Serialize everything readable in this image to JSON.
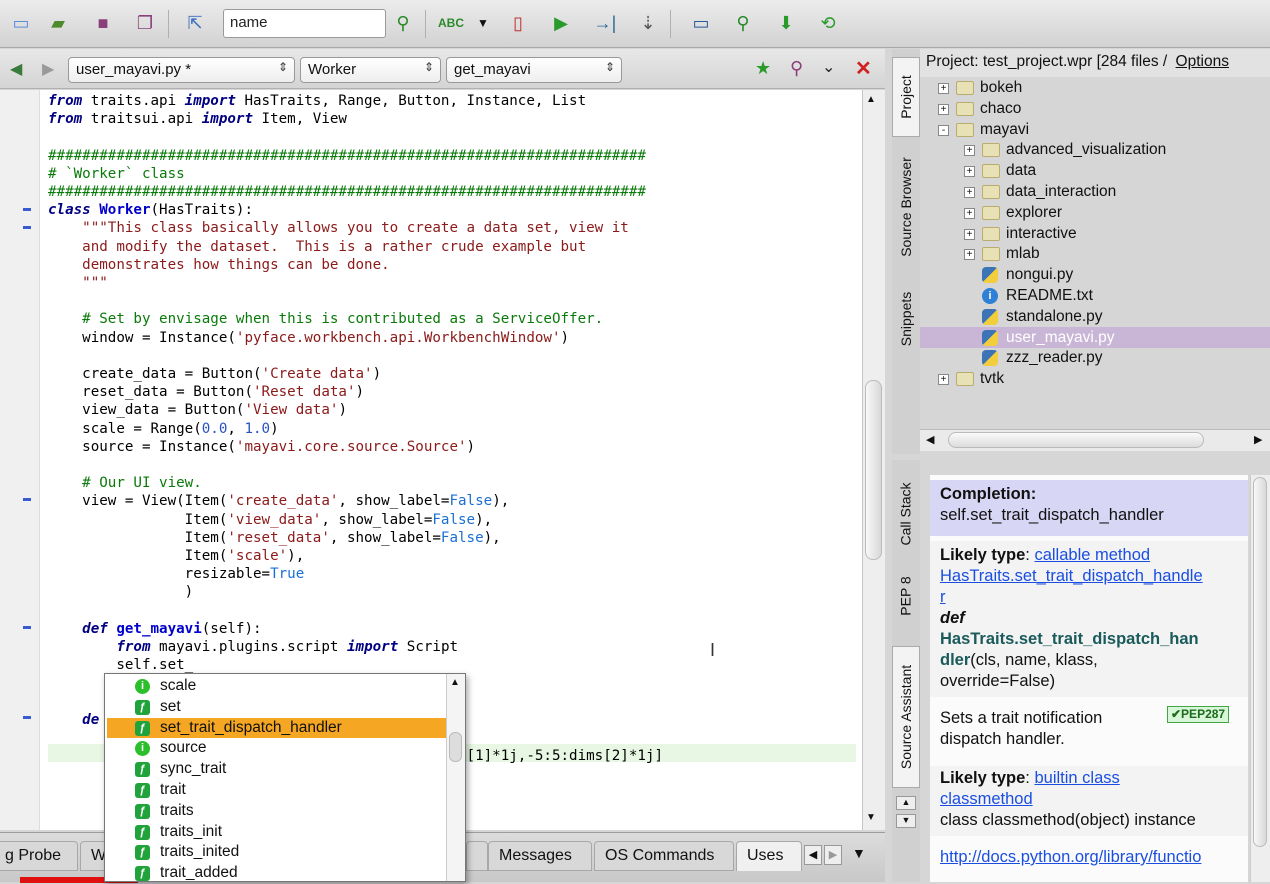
{
  "toolbar": {
    "search_value": "name"
  },
  "editor_nav": {
    "file": "user_mayavi.py *",
    "scope": "Worker",
    "method": "get_mayavi"
  },
  "completion": {
    "items": [
      {
        "label": "scale",
        "kind": "attribute"
      },
      {
        "label": "set",
        "kind": "method"
      },
      {
        "label": "set_trait_dispatch_handler",
        "kind": "method",
        "selected": true
      },
      {
        "label": "source",
        "kind": "attribute"
      },
      {
        "label": "sync_trait",
        "kind": "method"
      },
      {
        "label": "trait",
        "kind": "method"
      },
      {
        "label": "traits",
        "kind": "method"
      },
      {
        "label": "traits_init",
        "kind": "method"
      },
      {
        "label": "traits_inited",
        "kind": "method"
      },
      {
        "label": "trait_added",
        "kind": "method"
      }
    ]
  },
  "bottom_tabs": [
    "g Probe",
    "W",
    "Messages",
    "OS Commands",
    "Uses"
  ],
  "project": {
    "title": "Project: test_project.wpr [284 files /",
    "options": "Options"
  },
  "tree": [
    {
      "label": "bokeh",
      "level": 0,
      "type": "folder",
      "expand": "+"
    },
    {
      "label": "chaco",
      "level": 0,
      "type": "folder",
      "expand": "+"
    },
    {
      "label": "mayavi",
      "level": 0,
      "type": "folder",
      "expand": "-"
    },
    {
      "label": "advanced_visualization",
      "level": 1,
      "type": "folder",
      "expand": "+"
    },
    {
      "label": "data",
      "level": 1,
      "type": "folder",
      "expand": "+"
    },
    {
      "label": "data_interaction",
      "level": 1,
      "type": "folder",
      "expand": "+"
    },
    {
      "label": "explorer",
      "level": 1,
      "type": "folder",
      "expand": "+"
    },
    {
      "label": "interactive",
      "level": 1,
      "type": "folder",
      "expand": "+"
    },
    {
      "label": "mlab",
      "level": 1,
      "type": "folder",
      "expand": "+"
    },
    {
      "label": "nongui.py",
      "level": 1,
      "type": "py"
    },
    {
      "label": "README.txt",
      "level": 1,
      "type": "info"
    },
    {
      "label": "standalone.py",
      "level": 1,
      "type": "py"
    },
    {
      "label": "user_mayavi.py",
      "level": 1,
      "type": "py",
      "selected": true
    },
    {
      "label": "zzz_reader.py",
      "level": 1,
      "type": "py"
    },
    {
      "label": "tvtk",
      "level": 0,
      "type": "folder",
      "expand": "+"
    }
  ],
  "right_tabs_top": [
    "Project",
    "Source Browser",
    "Snippets"
  ],
  "right_tabs_bottom": [
    "Call Stack",
    "PEP 8",
    "Source Assistant"
  ],
  "assistant": {
    "completion_label": "Completion:",
    "completion_value": "self.set_trait_dispatch_handler",
    "likely_type_label": "Likely type",
    "likely_type_1": "callable method",
    "link_1": "HasTraits.set_trait_dispatch_handle",
    "link_1b": "r",
    "def_kw": "def",
    "sig_1": "HasTraits.set_trait_dispatch_han",
    "sig_2": "dler",
    "sig_3": "(cls, name, klass,",
    "sig_4": "override=False)",
    "desc_1": "Sets a trait notification",
    "desc_2": "dispatch handler.",
    "pep_badge": "✔PEP287",
    "likely_type_2": "builtin class",
    "link_2": "classmethod",
    "class_desc": "class classmethod(object) instance",
    "doc_link": "http://docs.python.org/library/functio"
  }
}
